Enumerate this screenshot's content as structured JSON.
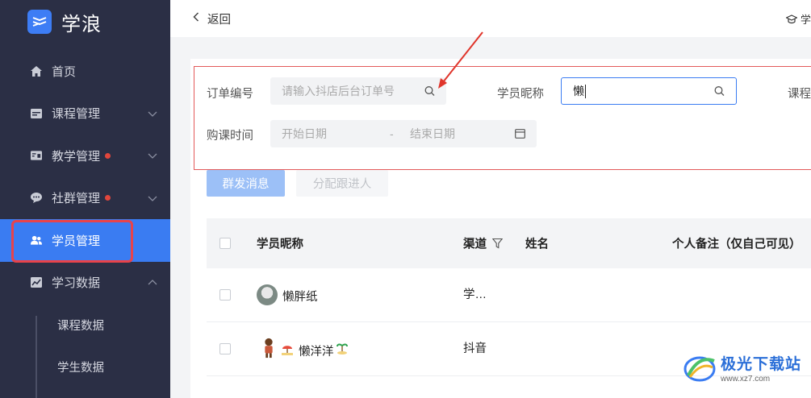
{
  "app": {
    "name": "学浪"
  },
  "sidebar": {
    "items": [
      {
        "label": "首页",
        "icon": "home-icon"
      },
      {
        "label": "课程管理",
        "icon": "calendar-icon"
      },
      {
        "label": "教学管理",
        "icon": "teaching-icon"
      },
      {
        "label": "社群管理",
        "icon": "chat-icon"
      },
      {
        "label": "学员管理",
        "icon": "users-icon"
      },
      {
        "label": "学习数据",
        "icon": "chart-icon"
      }
    ],
    "subitems": [
      {
        "label": "课程数据"
      },
      {
        "label": "学生数据"
      }
    ]
  },
  "topbar": {
    "back_label": "返回",
    "right_label": "学"
  },
  "filters": {
    "order_label": "订单编号",
    "order_placeholder": "请输入抖店后台订单号",
    "nickname_label": "学员昵称",
    "nickname_value": "懒",
    "course_label": "课程",
    "time_label": "购课时间",
    "start_placeholder": "开始日期",
    "separator": "-",
    "end_placeholder": "结束日期"
  },
  "actions": {
    "mass_message": "群发消息",
    "assign": "分配跟进人"
  },
  "table": {
    "headers": {
      "nickname": "学员昵称",
      "channel": "渠道",
      "name": "姓名",
      "note": "个人备注（仅自己可见）"
    },
    "rows": [
      {
        "nickname": "懒胖纸",
        "channel": "学…"
      },
      {
        "nickname": "懒洋洋",
        "channel": "抖音"
      }
    ]
  },
  "watermark": {
    "title": "极光下载站",
    "url": "www.xz7.com"
  },
  "colors": {
    "sidebar": "#2b2f45",
    "accent": "#3a7cf2",
    "highlight": "#e8434a"
  }
}
